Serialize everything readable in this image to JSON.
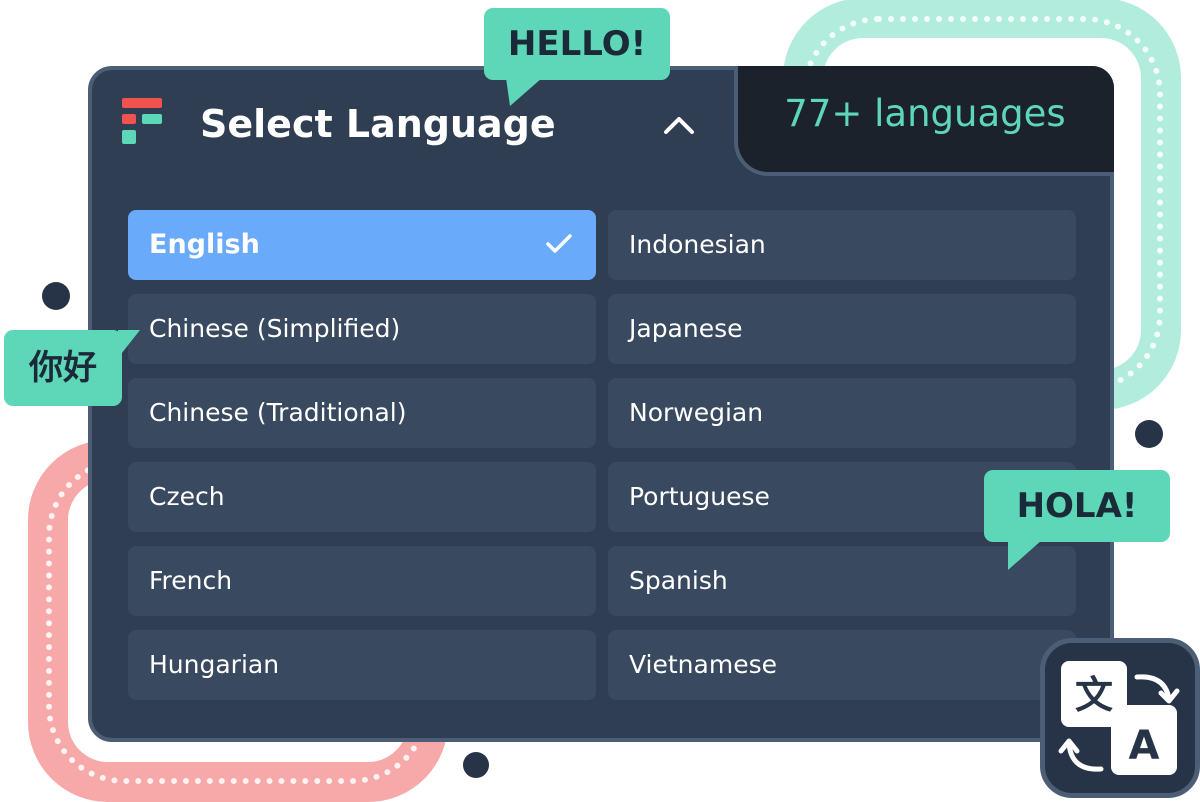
{
  "header": {
    "title": "Select Language",
    "languages_count": "77+ languages"
  },
  "languages": [
    {
      "label": "English",
      "selected": true
    },
    {
      "label": "Indonesian",
      "selected": false
    },
    {
      "label": "Chinese (Simplified)",
      "selected": false
    },
    {
      "label": "Japanese",
      "selected": false
    },
    {
      "label": "Chinese (Traditional)",
      "selected": false
    },
    {
      "label": "Norwegian",
      "selected": false
    },
    {
      "label": "Czech",
      "selected": false
    },
    {
      "label": "Portuguese",
      "selected": false
    },
    {
      "label": "French",
      "selected": false
    },
    {
      "label": "Spanish",
      "selected": false
    },
    {
      "label": "Hungarian",
      "selected": false
    },
    {
      "label": "Vietnamese",
      "selected": false
    }
  ],
  "bubbles": {
    "hello": "HELLO!",
    "nihao": "你好",
    "hola": "HOLA!"
  },
  "icons": {
    "logo": "brand-logo-icon",
    "collapse": "chevron-up-icon",
    "selected": "check-icon",
    "translate": "translate-icon",
    "translate_glyphs": [
      "文",
      "A"
    ]
  },
  "colors": {
    "panel": "#2f3e52",
    "item": "#39495f",
    "selected": "#6aaafa",
    "accent_green": "#5ed6b8",
    "accent_red": "#ef5350",
    "dark_tab": "#1b222c"
  }
}
